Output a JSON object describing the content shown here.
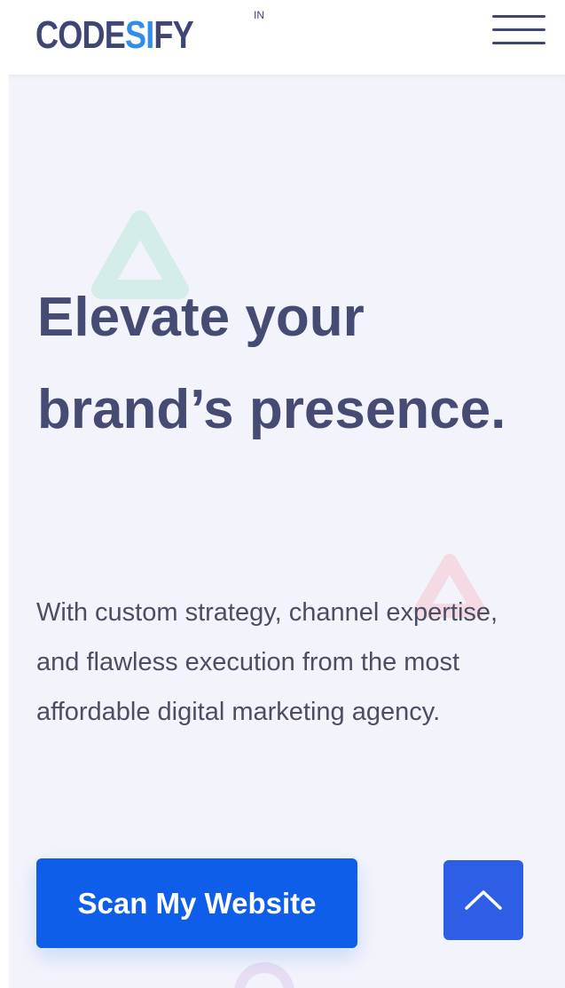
{
  "header": {
    "logo": {
      "part1": "CODE",
      "part2": "SI",
      "part3": "FY",
      "superscript": "IN"
    },
    "menu_icon": "hamburger-menu-icon"
  },
  "hero": {
    "title": "Elevate your brand’s presence.",
    "description": "With custom strategy, channel expertise, and flawless execution from the most affordable digital marketing agency.",
    "cta_label": "Scan My Website",
    "scroll_top_icon": "chevron-up-icon"
  },
  "colors": {
    "brand_navy": "#454b72",
    "brand_blue": "#0f5eea",
    "hero_background": "#f3f4fb",
    "scroll_top_background": "#2f5ee6"
  }
}
